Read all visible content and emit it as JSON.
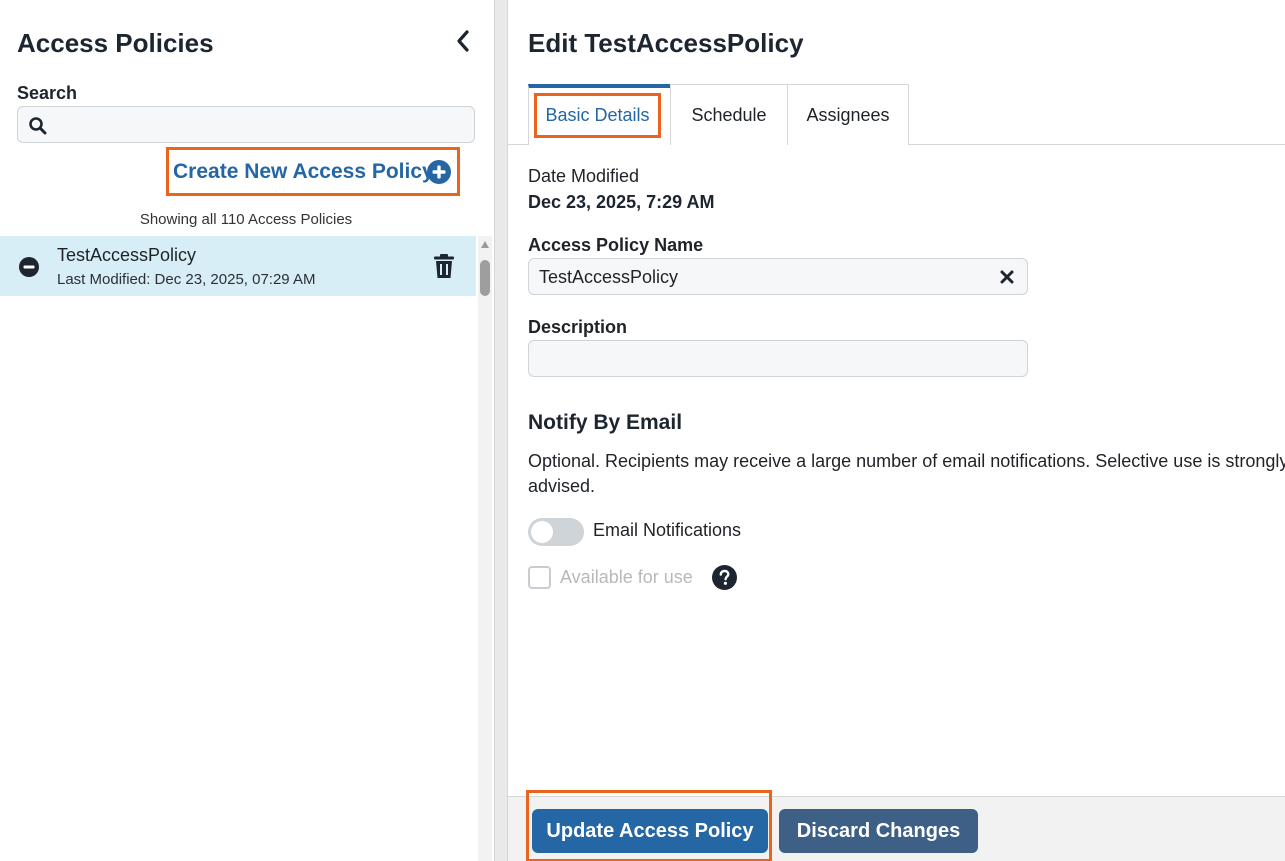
{
  "left_panel": {
    "title": "Access Policies",
    "search_label": "Search",
    "search_value": "",
    "create_link": "Create New Access Policy",
    "showing_text": "Showing all 110 Access Policies",
    "items": [
      {
        "name": "TestAccessPolicy",
        "meta": "Last Modified: Dec 23, 2025, 07:29 AM",
        "selected": true
      }
    ]
  },
  "editor": {
    "title": "Edit TestAccessPolicy",
    "tabs": [
      {
        "label": "Basic Details",
        "active": true
      },
      {
        "label": "Schedule",
        "active": false
      },
      {
        "label": "Assignees",
        "active": false
      }
    ],
    "date_modified_label": "Date Modified",
    "date_modified_value": "Dec 23, 2025, 7:29 AM",
    "name_label": "Access Policy Name",
    "name_value": "TestAccessPolicy",
    "description_label": "Description",
    "description_value": "",
    "notify_title": "Notify By Email",
    "notify_desc_line1": "Optional. Recipients may receive a large number of email notifications. Selective use is strongly",
    "notify_desc_line2": "advised.",
    "email_toggle_label": "Email Notifications",
    "email_toggle_on": false,
    "available_label": "Available for use",
    "available_checked": false
  },
  "footer": {
    "update_label": "Update Access Policy",
    "discard_label": "Discard Changes"
  },
  "colors": {
    "accent": "#2566a5",
    "highlight": "#e9641c",
    "selected_row": "#d7eef6",
    "discard": "#3e5f86"
  }
}
